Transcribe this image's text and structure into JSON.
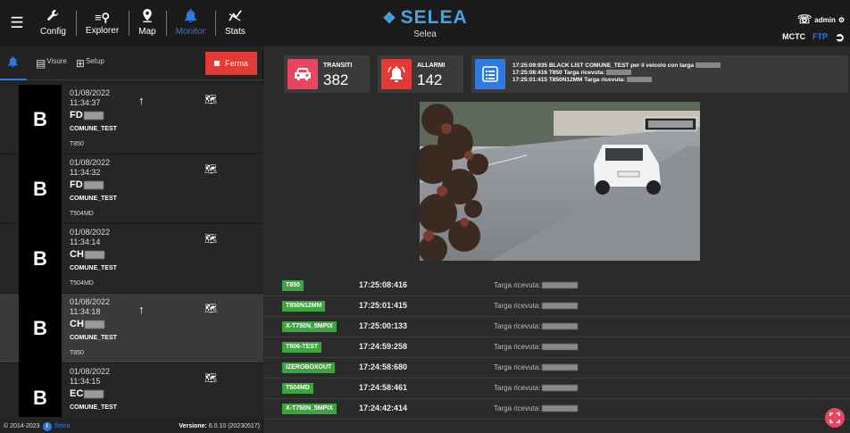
{
  "topbar": {
    "nav": [
      {
        "label": "Config",
        "icon": "wrench-icon"
      },
      {
        "label": "Explorer",
        "icon": "explorer-icon"
      },
      {
        "label": "Map",
        "icon": "map-pin-icon"
      },
      {
        "label": "Monitor",
        "icon": "bell-icon",
        "active": true
      },
      {
        "label": "Stats",
        "icon": "stats-icon"
      }
    ],
    "brand_name": "SELEA",
    "brand_sub": "Selea",
    "user": "admin",
    "mctc": "MCTC",
    "ftp": "FTP"
  },
  "left": {
    "tabs": {
      "visure": "Visure",
      "setup": "Setup"
    },
    "stop_label": "Ferma",
    "items": [
      {
        "country": "B",
        "date": "01/08/2022",
        "time": "11:34:37",
        "plate": "FD",
        "comune": "COMUNE_TEST",
        "camera": "T850",
        "arrow": true
      },
      {
        "country": "B",
        "date": "01/08/2022",
        "time": "11:34:32",
        "plate": "FD",
        "comune": "COMUNE_TEST",
        "camera": "T504MD",
        "arrow": false
      },
      {
        "country": "B",
        "date": "01/08/2022",
        "time": "11:34:14",
        "plate": "CH",
        "comune": "COMUNE_TEST",
        "camera": "T504MD",
        "arrow": false
      },
      {
        "country": "B",
        "date": "01/08/2022",
        "time": "11:34:18",
        "plate": "CH",
        "comune": "COMUNE_TEST",
        "camera": "T850",
        "arrow": true
      },
      {
        "country": "B",
        "date": "01/08/2022",
        "time": "11:34:15",
        "plate": "EC",
        "comune": "COMUNE_TEST",
        "camera": "",
        "arrow": false
      }
    ],
    "footer_copy": "© 2014-2023",
    "footer_brand": "Selea",
    "footer_version_label": "Versione:",
    "footer_version": "6.0.10 (20230517)"
  },
  "main": {
    "transiti": {
      "title": "TRANSITI",
      "value": "382"
    },
    "allarmi": {
      "title": "ALLARMI",
      "value": "142"
    },
    "log": [
      "17:25:09:935 BLACK LIST COMUNE_TEST per il veicolo con targa",
      "17:25:08:416 T850 Targa ricevuta:",
      "17:25:01:415 T850N12MM Targa ricevuta:"
    ],
    "rows": [
      {
        "camera": "T850",
        "time": "17:25:08:416",
        "msg": "Targa ricevuta:"
      },
      {
        "camera": "T850N12MM",
        "time": "17:25:01:415",
        "msg": "Targa ricevuta:"
      },
      {
        "camera": "X-T750N_5MPIX",
        "time": "17:25:00:133",
        "msg": "Targa ricevuta:"
      },
      {
        "camera": "T806-TEST",
        "time": "17:24:59:258",
        "msg": "Targa ricevuta:"
      },
      {
        "camera": "IZEROBOXOUT",
        "time": "17:24:58:680",
        "msg": "Targa ricevuta:"
      },
      {
        "camera": "T504MD",
        "time": "17:24:58:461",
        "msg": "Targa ricevuta:"
      },
      {
        "camera": "X-T750N_5MPIX",
        "time": "17:24:42:414",
        "msg": "Targa ricevuta:"
      }
    ]
  },
  "colors": {
    "accent": "#2d7be0",
    "danger": "#e53935",
    "pink": "#e84660",
    "green": "#3fa33f"
  }
}
